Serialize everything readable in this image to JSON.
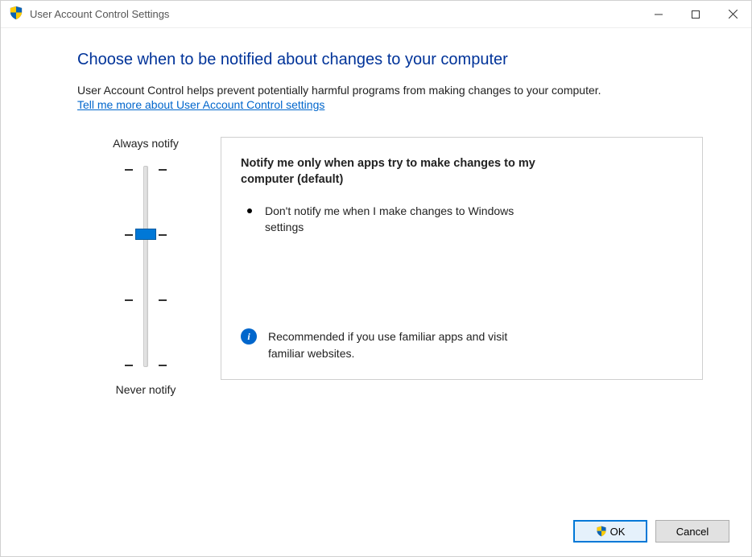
{
  "window": {
    "title": "User Account Control Settings"
  },
  "heading": "Choose when to be notified about changes to your computer",
  "intro": "User Account Control helps prevent potentially harmful programs from making changes to your computer.",
  "link_text": "Tell me more about User Account Control settings",
  "slider": {
    "top_label": "Always notify",
    "bottom_label": "Never notify",
    "position": 1,
    "steps": 4
  },
  "panel": {
    "title": "Notify me only when apps try to make changes to my computer (default)",
    "bullet": "Don't notify me when I make changes to Windows settings",
    "recommendation": "Recommended if you use familiar apps and visit familiar websites."
  },
  "footer": {
    "ok_label": "OK",
    "cancel_label": "Cancel"
  }
}
